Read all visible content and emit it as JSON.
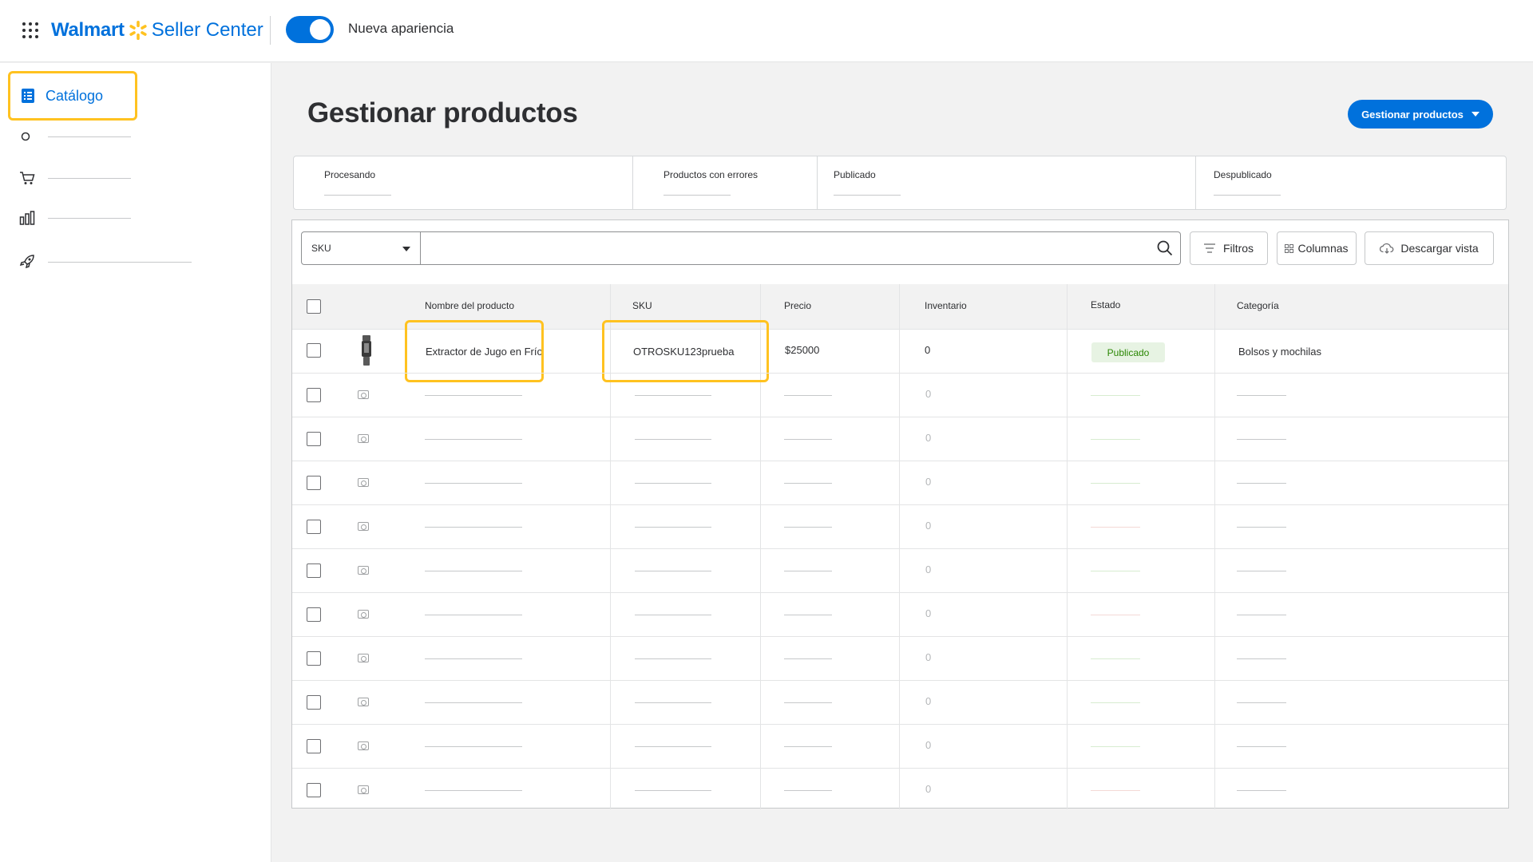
{
  "header": {
    "brand": "Walmart",
    "product": "Seller Center",
    "toggle_label": "Nueva apariencia"
  },
  "sidebar": {
    "active_item": "Catálogo",
    "icons": [
      "catalog-icon",
      "circle-icon",
      "cart-icon",
      "bar-chart-icon",
      "rocket-icon"
    ]
  },
  "main": {
    "title": "Gestionar productos",
    "primary_button": "Gestionar productos",
    "stats": [
      "Procesando",
      "Productos con errores",
      "Publicado",
      "Despublicado"
    ],
    "toolbar": {
      "search_by": "SKU",
      "filters": "Filtros",
      "columns": "Columnas",
      "download": "Descargar vista"
    },
    "columns": [
      "Nombre del producto",
      "SKU",
      "Precio",
      "Inventario",
      "Estado",
      "Categoría"
    ],
    "product": {
      "name": "Extractor de Jugo en Frío",
      "sku": "OTROSKU123prueba",
      "price": "$25000",
      "inventory": "0",
      "status": "Publicado",
      "category": "Bolsos y mochilas"
    },
    "placeholder_zero": "0",
    "colors": {
      "accent": "#0071dc",
      "highlight": "#ffc220",
      "published_bg": "#e7f3e3",
      "published_text": "#2a8703"
    }
  }
}
